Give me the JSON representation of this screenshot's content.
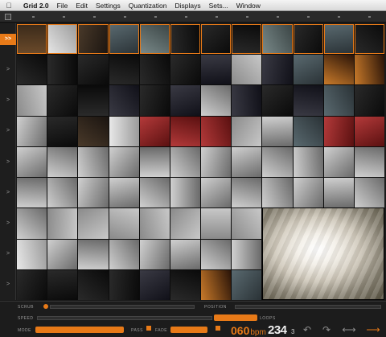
{
  "menubar": {
    "apple_icon": "apple-icon",
    "app_name": "Grid 2.0",
    "items": [
      "File",
      "Edit",
      "Settings",
      "Quantization",
      "Displays",
      "Sets...",
      "Window"
    ]
  },
  "rows": {
    "active_marker": ">>",
    "marker": ">"
  },
  "controls": {
    "scrub_label": "SCRUB",
    "position_label": "POSITION",
    "speed_label": "SPEED",
    "loops_label": "LOOPS",
    "mode_label": "MODE",
    "pass_label": "PASS",
    "fade_label": "FADE",
    "bpm_value": "060",
    "bpm_unit": "bpm",
    "counter": "234",
    "counter_sub": "3",
    "nav_icons": [
      "loop-back-icon",
      "loop-forward-icon",
      "arrow-both-icon",
      "arrow-right-icon"
    ]
  },
  "colors": {
    "accent": "#e87a18",
    "background": "#1a1a1a"
  }
}
